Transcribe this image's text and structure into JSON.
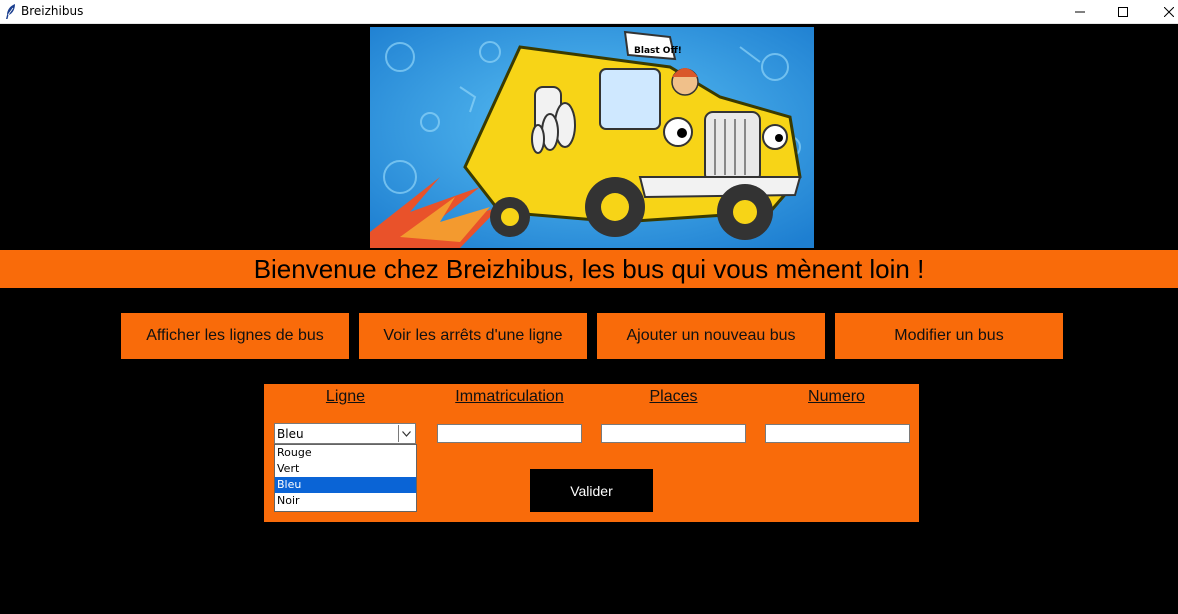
{
  "window": {
    "title": "Breizhibus",
    "icons": {
      "app": "feather-icon",
      "minimize": "minimize-icon",
      "maximize": "maximize-icon",
      "close": "close-icon"
    }
  },
  "hero": {
    "sign_text": "Blast Off!",
    "colors": {
      "background": "#2a8fd8",
      "bus": "#f7d417",
      "flame": "#e9522a"
    }
  },
  "banner": {
    "text": "Bienvenue chez Breizhibus, les bus qui vous mènent loin !"
  },
  "nav": {
    "buttons": [
      "Afficher les lignes de bus",
      "Voir les arrêts d'une ligne",
      "Ajouter un nouveau bus",
      "Modifier un bus"
    ]
  },
  "form": {
    "headers": {
      "ligne": "Ligne",
      "immatriculation": "Immatriculation",
      "places": "Places",
      "numero": "Numero"
    },
    "ligne": {
      "value": "Bleu",
      "options": [
        "Rouge",
        "Vert",
        "Bleu",
        "Noir"
      ],
      "selected": "Bleu"
    },
    "immatriculation_value": "",
    "places_value": "",
    "numero_value": "",
    "submit_label": "Valider"
  },
  "colors": {
    "accent": "#f96b0a",
    "background": "#000000",
    "selection": "#0a64d6"
  }
}
